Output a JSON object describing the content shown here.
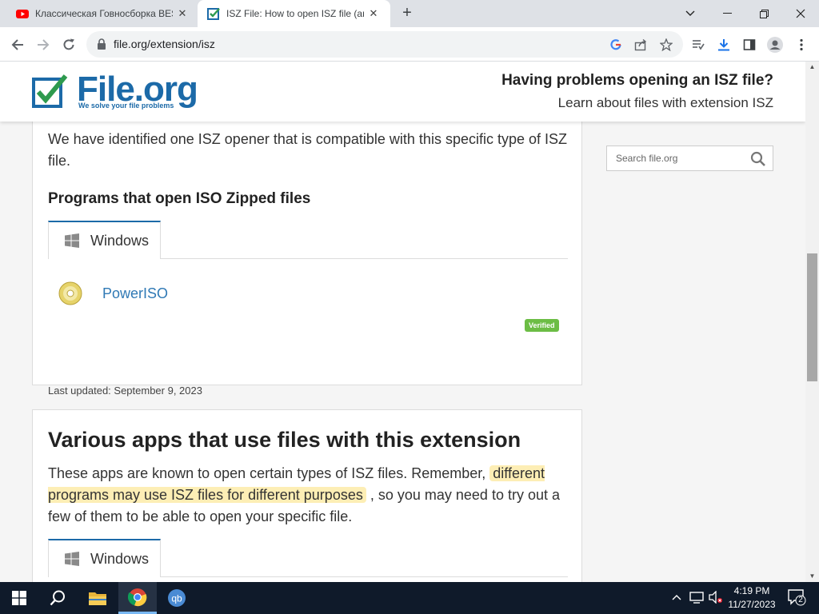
{
  "browser": {
    "tabs": [
      {
        "title": "Классическая Говносборка BES",
        "favicon": "youtube-icon",
        "active": false
      },
      {
        "title": "ISZ File: How to open ISZ file (and",
        "favicon": "file-org-check-icon",
        "active": true
      }
    ],
    "new_tab_label": "+",
    "url": "file.org/extension/isz"
  },
  "site": {
    "logo_text": "File.org",
    "logo_tagline": "We solve your file problems",
    "header_question": "Having problems opening an ISZ file?",
    "header_sub": "Learn about files with extension ISZ",
    "search_placeholder": "Search file.org"
  },
  "section1": {
    "intro": "We have identified one ISZ opener that is compatible with this specific type of ISZ file.",
    "heading": "Programs that open ISO Zipped files",
    "os_tab": "Windows",
    "program_name": "PowerISO",
    "verified_badge": "Verified",
    "last_updated": "Last updated: September 9, 2023"
  },
  "section2": {
    "heading": "Various apps that use files with this extension",
    "text_before": "These apps are known to open certain types of ISZ files. Remember,",
    "text_highlight": "different programs may use ISZ files for different purposes",
    "text_after": ", so you may need to try out a few of them to be able to open your specific file.",
    "os_tab": "Windows"
  },
  "taskbar": {
    "time": "4:19 PM",
    "date": "11/27/2023",
    "notification_count": "2"
  },
  "colors": {
    "brand_blue": "#1c6aa8",
    "brand_green": "#2e9a4e",
    "link_blue": "#2f79b5",
    "verified_green": "#6cbd45",
    "highlight_yellow": "#fdeeb5"
  }
}
